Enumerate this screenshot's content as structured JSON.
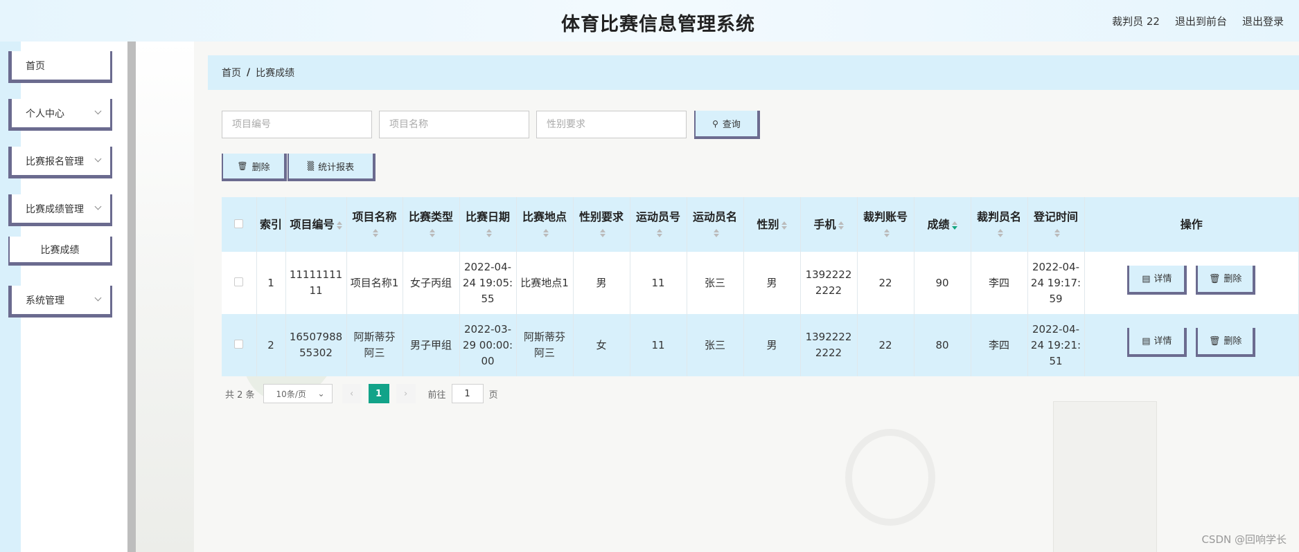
{
  "header": {
    "title": "体育比赛信息管理系统",
    "user_label": "裁判员 22",
    "to_front": "退出到前台",
    "logout": "退出登录"
  },
  "sidebar": {
    "items": [
      {
        "label": "首页"
      },
      {
        "label": "个人中心"
      },
      {
        "label": "比赛报名管理"
      },
      {
        "label": "比赛成绩管理"
      },
      {
        "label": "比赛成绩"
      },
      {
        "label": "系统管理"
      }
    ]
  },
  "breadcrumb": {
    "home": "首页",
    "sep": "/",
    "current": "比赛成绩"
  },
  "search": {
    "project_no_placeholder": "项目编号",
    "project_name_placeholder": "项目名称",
    "gender_placeholder": "性别要求",
    "query_label": "查询"
  },
  "toolbar": {
    "delete_label": "删除",
    "report_label": "统计报表"
  },
  "table": {
    "headers": [
      "索引",
      "项目编号",
      "项目名称",
      "比赛类型",
      "比赛日期",
      "比赛地点",
      "性别要求",
      "运动员号",
      "运动员名",
      "性别",
      "手机",
      "裁判账号",
      "成绩",
      "裁判员名",
      "登记时间",
      "操作"
    ],
    "rows": [
      {
        "index": "1",
        "project_no": "1111111111",
        "project_name": "项目名称1",
        "type": "女子丙组",
        "date": "2022-04-24 19:05:55",
        "place": "比赛地点1",
        "gender_req": "男",
        "athlete_no": "11",
        "athlete_name": "张三",
        "gender": "男",
        "phone": "13922222222",
        "referee_account": "22",
        "score": "90",
        "referee_name": "李四",
        "reg_time": "2022-04-24 19:17:59"
      },
      {
        "index": "2",
        "project_no": "1650798855302",
        "project_name": "阿斯蒂芬阿三",
        "type": "男子甲组",
        "date": "2022-03-29 00:00:00",
        "place": "阿斯蒂芬阿三",
        "gender_req": "女",
        "athlete_no": "11",
        "athlete_name": "张三",
        "gender": "男",
        "phone": "13922222222",
        "referee_account": "22",
        "score": "80",
        "referee_name": "李四",
        "reg_time": "2022-04-24 19:21:51"
      }
    ],
    "detail_label": "详情",
    "delete_label": "删除"
  },
  "pagination": {
    "total": "共 2 条",
    "page_size": "10条/页",
    "current_page": "1",
    "goto_prefix": "前往",
    "goto_value": "1",
    "goto_suffix": "页"
  },
  "watermark": "CSDN @回响学长",
  "colors": {
    "accent": "#d8f0fb",
    "border": "#6b6b8f",
    "page_active": "#12a389",
    "sort_active": "#12a57e"
  }
}
